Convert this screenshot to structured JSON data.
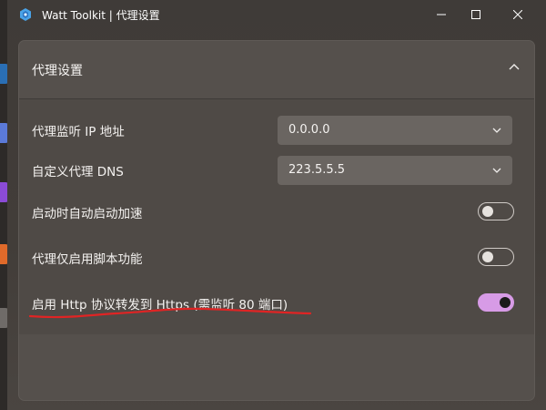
{
  "window": {
    "title": "Watt Toolkit | 代理设置",
    "controls": [
      "minimize-icon",
      "maximize-icon",
      "close-icon"
    ]
  },
  "section": {
    "title": "代理设置",
    "expanded": true
  },
  "settings": {
    "listen_ip": {
      "label": "代理监听 IP 地址",
      "value": "0.0.0.0"
    },
    "custom_dns": {
      "label": "自定义代理 DNS",
      "value": "223.5.5.5"
    },
    "auto_start": {
      "label": "启动时自动启动加速",
      "on": false
    },
    "script_only": {
      "label": "代理仅启用脚本功能",
      "on": false
    },
    "http_to_https": {
      "label": "启用 Http 协议转发到 Https (需监听 80 端口)",
      "on": true
    }
  },
  "colors": {
    "accent": "#d79be6",
    "annotation": "#e02424",
    "card": "#55504c",
    "window": "#3f3b38"
  },
  "annotation": {
    "type": "red-underline-on-last-setting"
  }
}
